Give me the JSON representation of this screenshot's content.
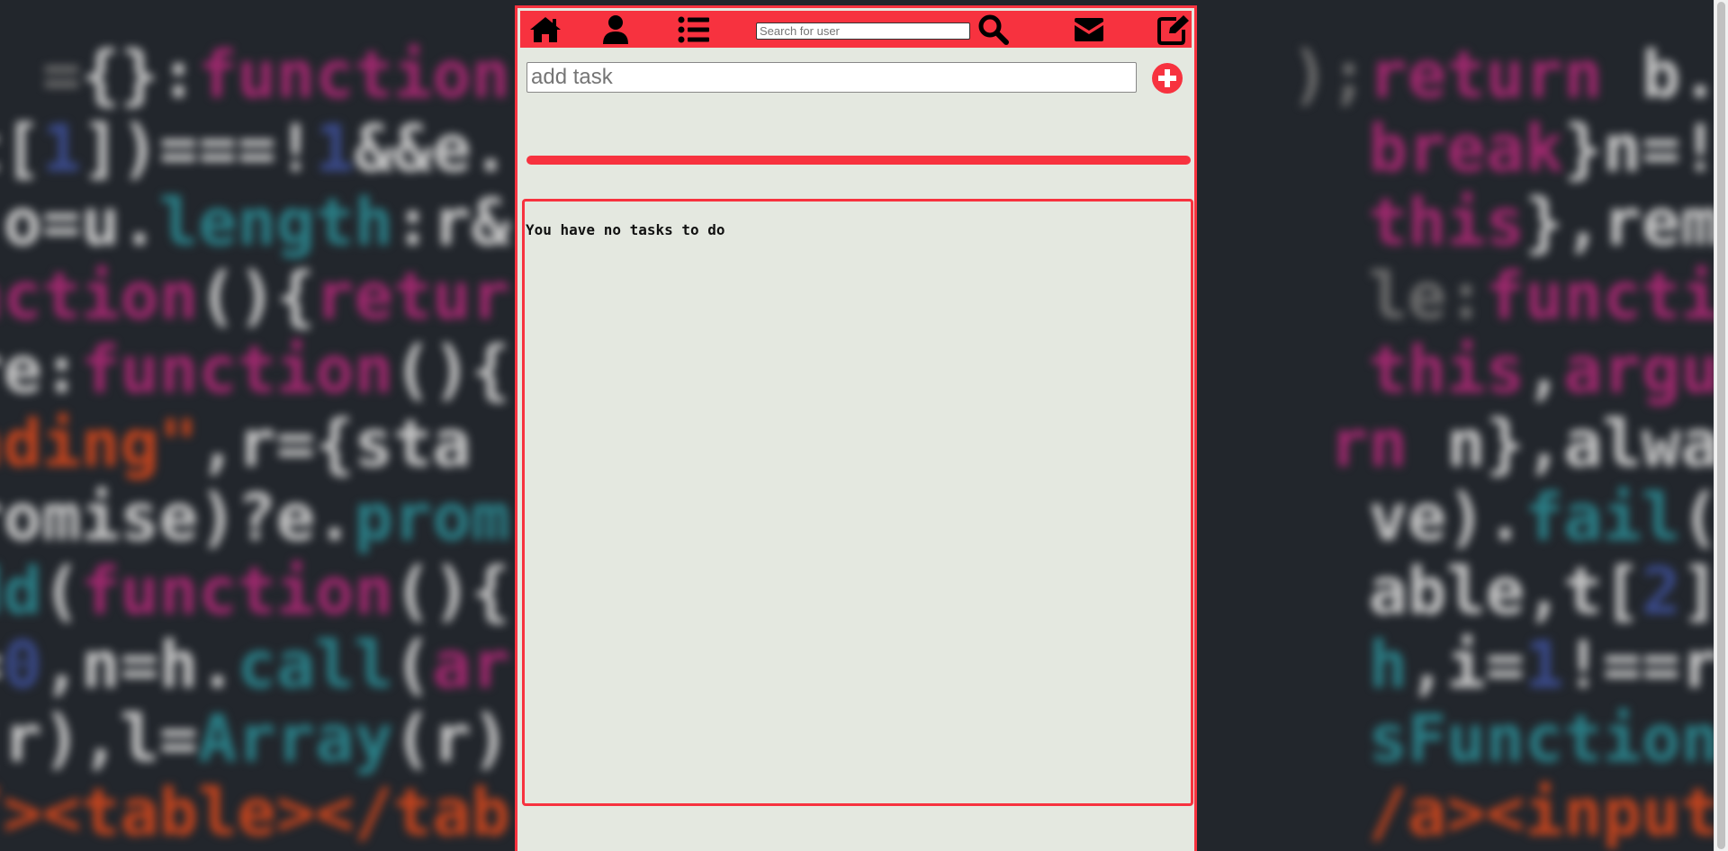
{
  "colors": {
    "accent": "#f7323f",
    "panel_background": "#e4e8e0",
    "icon": "#000000"
  },
  "navbar": {
    "icons": [
      "home-icon",
      "user-icon",
      "list-icon",
      "search-icon",
      "envelope-icon",
      "edit-icon"
    ],
    "search": {
      "placeholder": "Search for user",
      "value": ""
    }
  },
  "task_form": {
    "placeholder": "add task",
    "value": "",
    "add_icon": "plus-circle-icon"
  },
  "tasks": {
    "empty_message": "You have no tasks to do",
    "items": []
  }
}
